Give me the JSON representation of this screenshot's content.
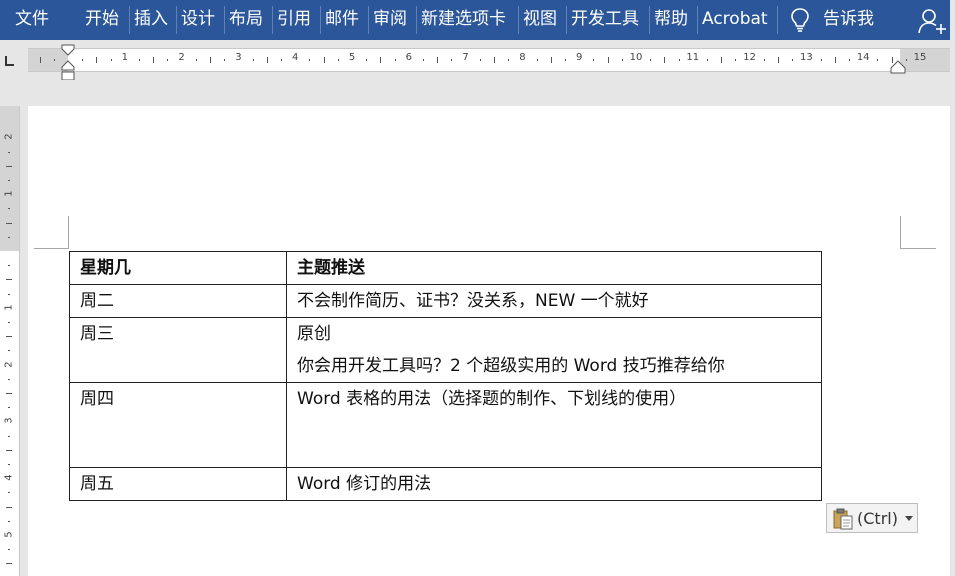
{
  "ribbon": {
    "tabs": [
      {
        "id": "file",
        "label": "文件"
      },
      {
        "id": "home",
        "label": "开始"
      },
      {
        "id": "insert",
        "label": "插入"
      },
      {
        "id": "design",
        "label": "设计"
      },
      {
        "id": "layout",
        "label": "布局"
      },
      {
        "id": "references",
        "label": "引用"
      },
      {
        "id": "mailings",
        "label": "邮件"
      },
      {
        "id": "review",
        "label": "审阅"
      },
      {
        "id": "new-tab",
        "label": "新建选项卡"
      },
      {
        "id": "view",
        "label": "视图"
      },
      {
        "id": "developer",
        "label": "开发工具"
      },
      {
        "id": "help",
        "label": "帮助"
      },
      {
        "id": "acrobat",
        "label": "Acrobat"
      }
    ],
    "tell_me": "告诉我",
    "tell_me_icon": "lightbulb-icon",
    "share_icon": "person-add-icon",
    "background": "#2b579a"
  },
  "ruler": {
    "numbers": [
      "1",
      "2",
      "3",
      "4",
      "5",
      "6",
      "7",
      "8",
      "9",
      "10",
      "11",
      "12",
      "13",
      "14",
      "15"
    ]
  },
  "vertical_ruler": {
    "numbers_top": [
      "2",
      "1"
    ],
    "numbers_bottom": [
      "1",
      "2",
      "3",
      "4",
      "5"
    ]
  },
  "table": {
    "header": [
      "星期几",
      "主题推送"
    ],
    "rows": [
      {
        "day": "周二",
        "lines": [
          "不会制作简历、证书？没关系，NEW 一个就好"
        ]
      },
      {
        "day": "周三",
        "lines": [
          "原创",
          "你会用开发工具吗？2 个超级实用的 Word 技巧推荐给你"
        ]
      },
      {
        "day": "周四",
        "lines": [
          "Word 表格的用法（选择题的制作、下划线的使用）",
          ""
        ]
      },
      {
        "day": "周五",
        "lines": [
          "Word 修订的用法"
        ]
      }
    ]
  },
  "paste_options": {
    "label": "(Ctrl)",
    "icon": "clipboard-paste-icon"
  }
}
